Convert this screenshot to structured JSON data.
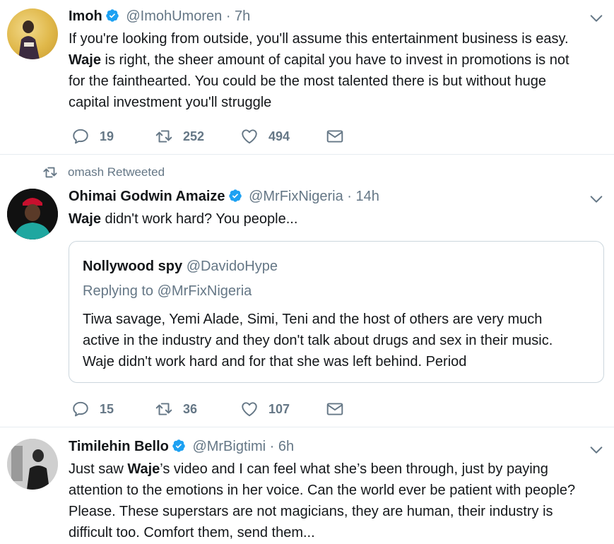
{
  "tweets": [
    {
      "name": "Imoh",
      "handle": "@ImohUmoren",
      "dot": "·",
      "time": "7h",
      "text_lines": [
        "If you're looking from outside, you'll assume this entertainment business is easy.",
        {
          "bold": "Waje",
          "rest": " is right, the sheer amount of capital you have to invest in promotions is not"
        },
        "for the fainthearted. You could be the most talented there is but without huge",
        "capital investment you'll struggle"
      ],
      "replies": "19",
      "retweets": "252",
      "likes": "494"
    },
    {
      "retweeted_by": "omash Retweeted",
      "name": "Ohimai Godwin Amaize",
      "handle": "@MrFixNigeria",
      "dot": "·",
      "time": "14h",
      "text_bold": "Waje",
      "text_rest": " didn't work hard? You people...",
      "quote": {
        "name": "Nollywood spy",
        "handle": "@DavidoHype",
        "replying": "Replying to @MrFixNigeria",
        "lines": [
          "Tiwa savage, Yemi Alade, Simi, Teni and the host of others are very much",
          "active in the industry and they don't talk about drugs and sex in their music.",
          "Waje didn't work hard and for that she was left behind. Period"
        ]
      },
      "replies": "15",
      "retweets": "36",
      "likes": "107"
    },
    {
      "name": "Timilehin Bello",
      "handle": "@MrBigtimi",
      "dot": "·",
      "time": "6h",
      "line1_pre": "Just saw ",
      "line1_bold": "Waje",
      "line1_rest": "’s video and I can feel what she’s been through, just by paying",
      "lines": [
        "attention to the emotions in her voice. Can the world ever be patient with people?",
        "Please. These superstars are not magicians, they are human, their industry is",
        "difficult too. Comfort them, send them..."
      ]
    }
  ],
  "colors": {
    "verified": "#1da1f2",
    "muted": "#657786",
    "border": "#e6ecf0"
  }
}
